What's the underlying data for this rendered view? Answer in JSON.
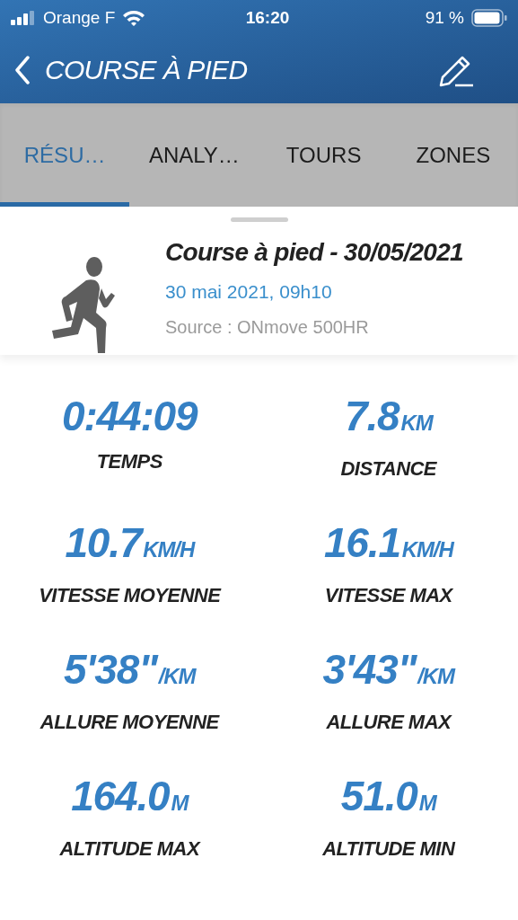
{
  "status_bar": {
    "carrier": "Orange F",
    "time": "16:20",
    "battery": "91 %"
  },
  "nav": {
    "title": "COURSE À PIED"
  },
  "tabs": [
    {
      "label": "RÉSU…",
      "selected": true
    },
    {
      "label": "ANALY…",
      "selected": false
    },
    {
      "label": "TOURS",
      "selected": false
    },
    {
      "label": "ZONES",
      "selected": false
    }
  ],
  "activity": {
    "title": "Course à pied - 30/05/2021",
    "datetime": "30 mai 2021, 09h10",
    "source": "Source : ONmove 500HR"
  },
  "stats": [
    {
      "value": "0:44:09",
      "label": "TEMPS"
    },
    {
      "value": "7.8",
      "unit": "KM",
      "label": "DISTANCE"
    },
    {
      "value": "10.7",
      "unit": "KM/H",
      "label": "VITESSE MOYENNE"
    },
    {
      "value": "16.1",
      "unit": "KM/H",
      "label": "VITESSE MAX"
    },
    {
      "value": "5'38\"",
      "unit": "/KM",
      "label": "ALLURE MOYENNE"
    },
    {
      "value": "3'43\"",
      "unit": "/KM",
      "label": "ALLURE MAX"
    },
    {
      "value": "164.0",
      "unit": "M",
      "label": "ALTITUDE MAX"
    },
    {
      "value": "51.0",
      "unit": "M",
      "label": "ALTITUDE MIN"
    }
  ]
}
